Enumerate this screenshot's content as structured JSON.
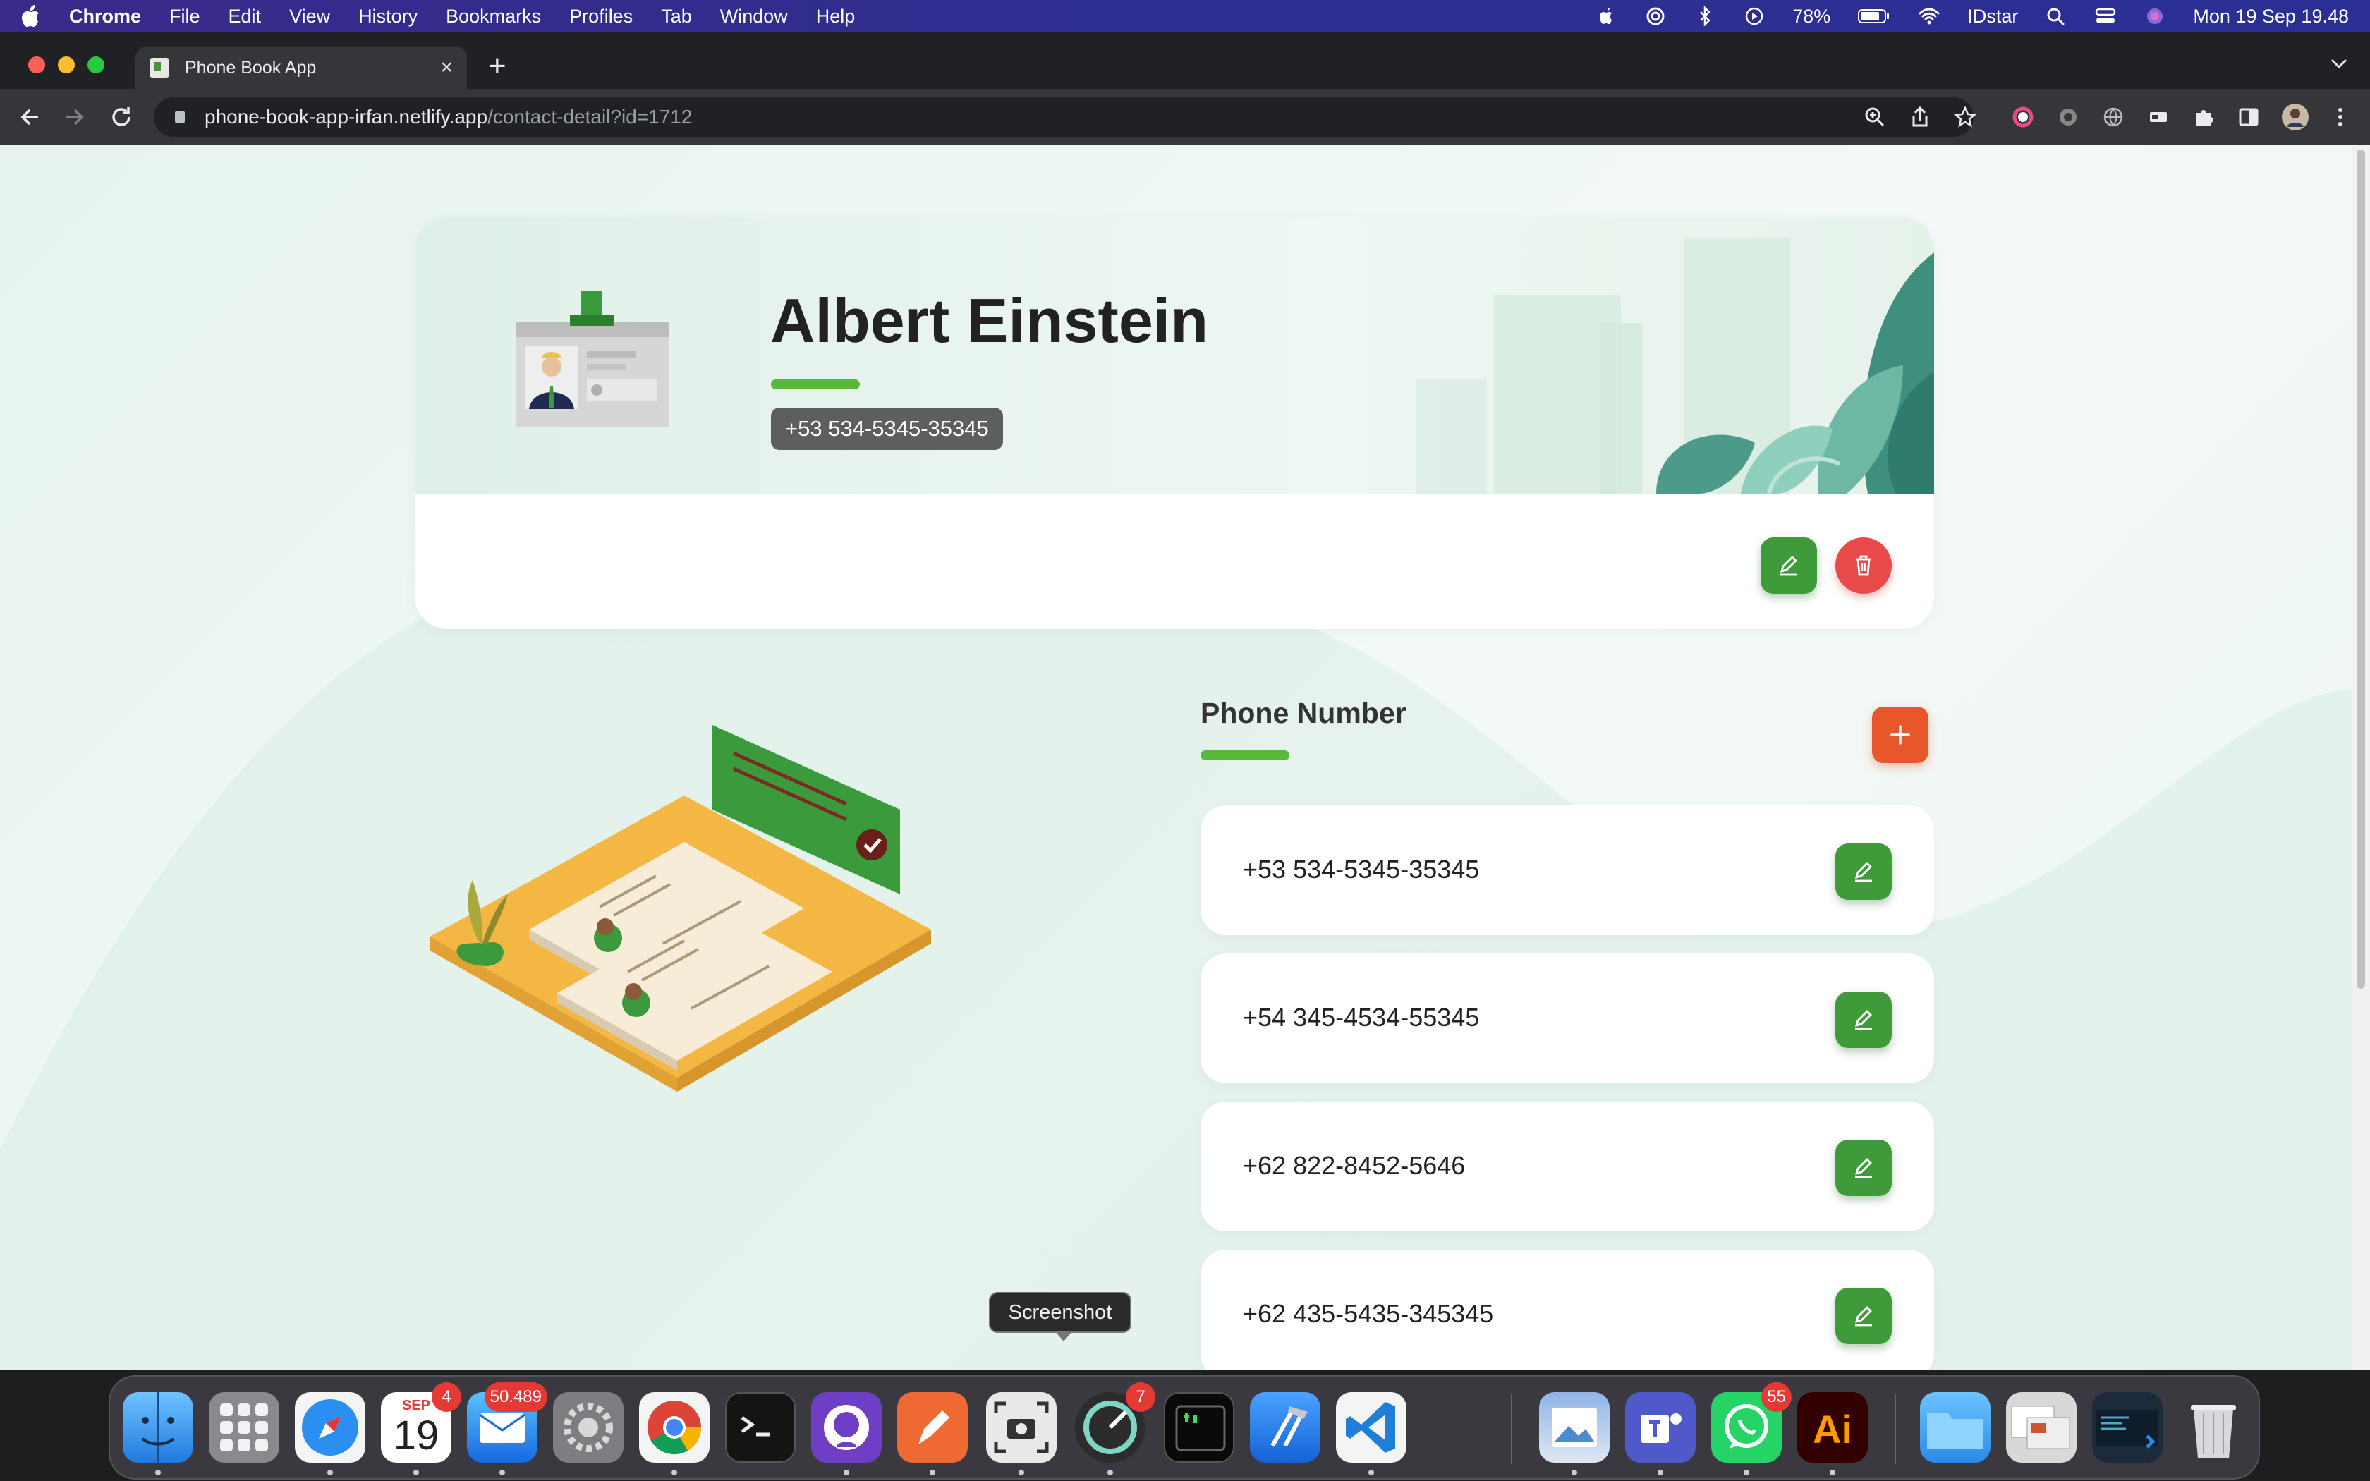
{
  "menubar": {
    "app_name": "Chrome",
    "items": [
      "File",
      "Edit",
      "View",
      "History",
      "Bookmarks",
      "Profiles",
      "Tab",
      "Window",
      "Help"
    ],
    "battery": "78%",
    "user": "IDstar",
    "datetime": "Mon 19 Sep  19.48"
  },
  "browser": {
    "tab_title": "Phone Book App",
    "url_host": "phone-book-app-irfan.netlify.app",
    "url_path": "/contact-detail?id=1712"
  },
  "contact": {
    "name": "Albert Einstein",
    "primary_phone": "+53 534-5345-35345"
  },
  "phones": {
    "title": "Phone Number",
    "items": [
      "+53 534-5345-35345",
      "+54 345-4534-55345",
      "+62 822-8452-5646",
      "+62 435-5435-345345"
    ]
  },
  "tooltip": "Screenshot",
  "dock": {
    "calendar_month": "SEP",
    "calendar_day": "19",
    "calendar_badge": "4",
    "mail_badge": "50.489",
    "app_badge": "7",
    "whatsapp_badge": "55",
    "illustrator_label": "Ai"
  },
  "colors": {
    "accent_green": "#3f9a3a",
    "delete_red": "#e84a4a",
    "add_orange": "#e8572a",
    "underline_green": "#58b83a"
  }
}
